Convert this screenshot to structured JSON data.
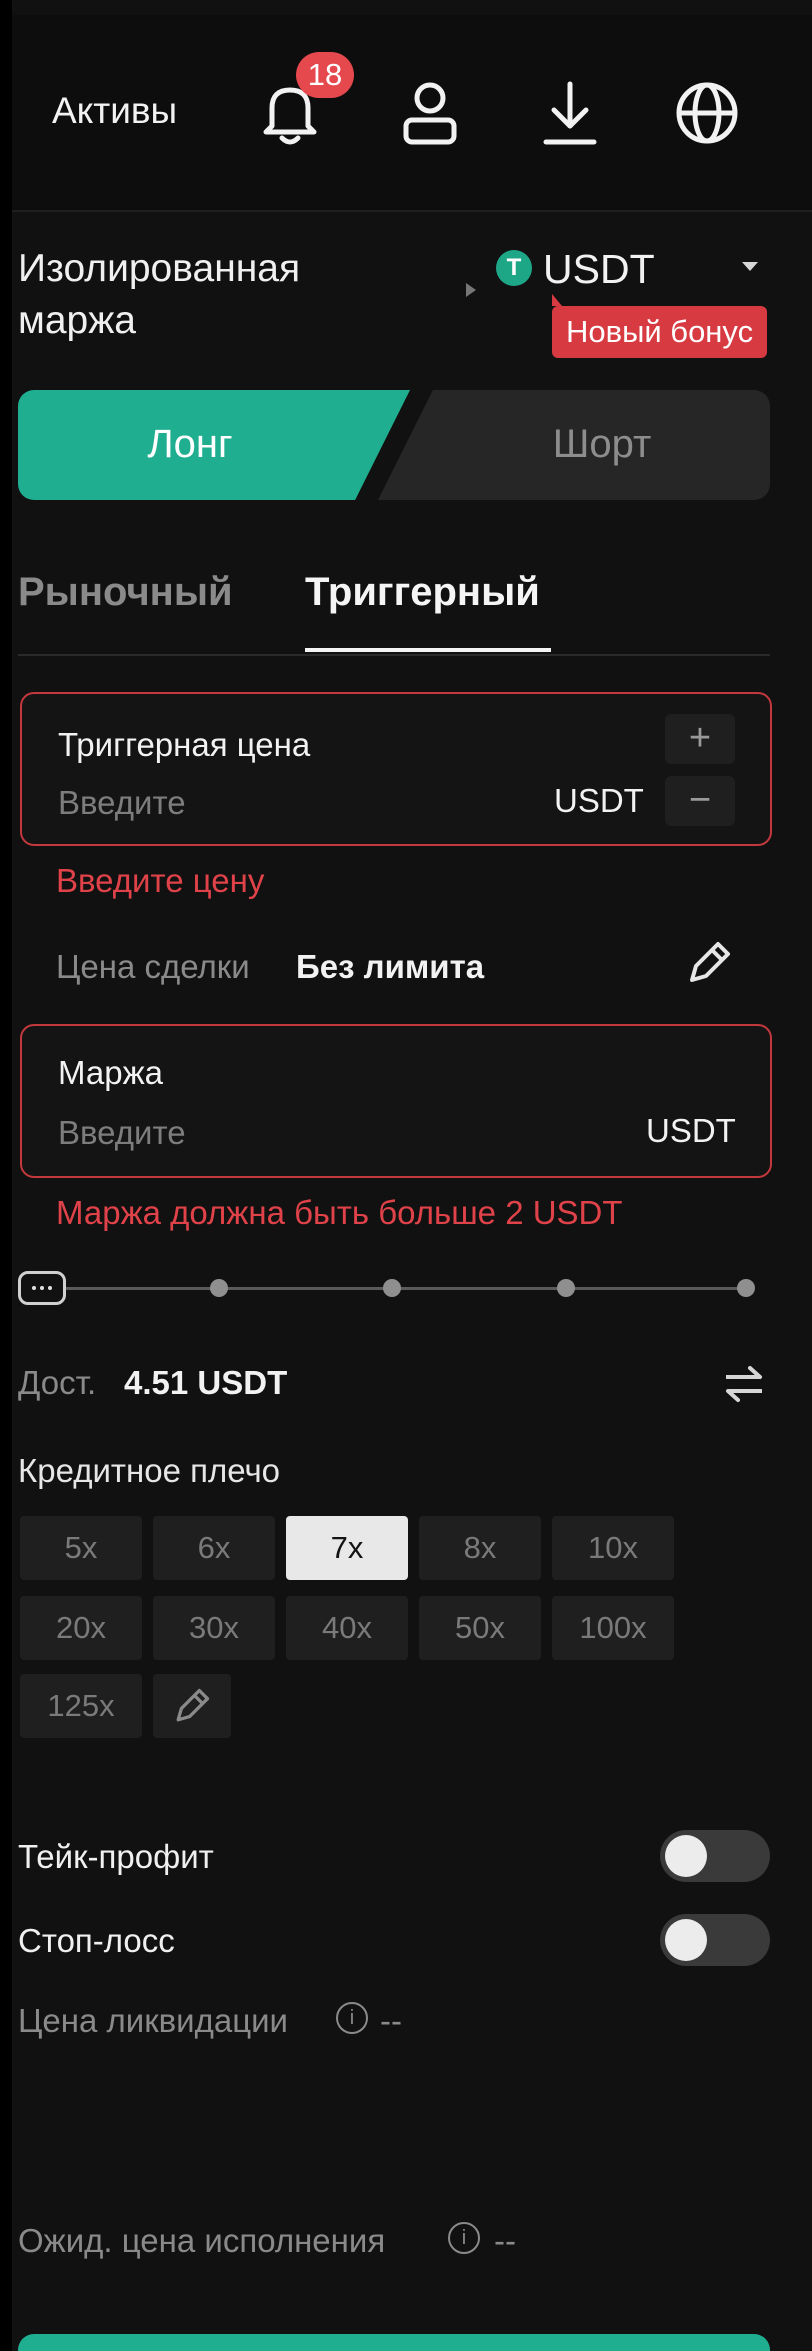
{
  "header": {
    "assets_label": "Активы",
    "notifications_count": "18"
  },
  "margin": {
    "type_label": "Изолированная маржа",
    "coin_symbol": "T",
    "coin_label": "USDT",
    "bonus_label": "Новый бонус"
  },
  "side": {
    "long_label": "Лонг",
    "short_label": "Шорт"
  },
  "order_tabs": {
    "market_label": "Рыночный",
    "trigger_label": "Триггерный"
  },
  "trigger_price": {
    "title": "Триггерная цена",
    "placeholder": "Введите",
    "unit": "USDT",
    "plus": "+",
    "minus": "−",
    "error": "Введите цену"
  },
  "deal_price": {
    "label": "Цена сделки",
    "value": "Без лимита"
  },
  "margin_input": {
    "title": "Маржа",
    "placeholder": "Введите",
    "unit": "USDT",
    "error": "Маржа должна быть больше 2 USDT"
  },
  "slider": {
    "value_fraction": 0
  },
  "available": {
    "label": "Дост.",
    "value": "4.51 USDT"
  },
  "leverage": {
    "title": "Кредитное плечо",
    "options": [
      "5x",
      "6x",
      "7x",
      "8x",
      "10x",
      "20x",
      "30x",
      "40x",
      "50x",
      "100x",
      "125x"
    ],
    "selected": "7x"
  },
  "take_profit": {
    "label": "Тейк-профит",
    "enabled": false
  },
  "stop_loss": {
    "label": "Стоп-лосс",
    "enabled": false
  },
  "liquidation": {
    "label": "Цена ликвидации",
    "value": "--"
  },
  "expected": {
    "label": "Ожид. цена исполнения",
    "value": "--"
  },
  "colors": {
    "accent": "#1fae90",
    "error": "#e04249",
    "badge": "#e5484d"
  },
  "icons": [
    "bell-icon",
    "user-icon",
    "download-icon",
    "globe-icon",
    "edit-icon",
    "swap-icon",
    "info-icon"
  ]
}
